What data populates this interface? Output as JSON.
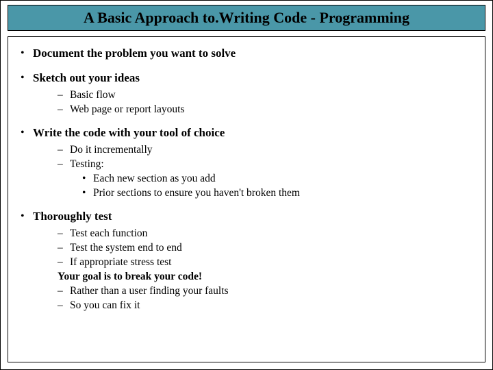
{
  "title": "A Basic Approach to.Writing Code - Programming",
  "b1": "Document the problem you want to solve",
  "b2": "Sketch out your ideas",
  "b2s1": "Basic flow",
  "b2s2": "Web page or report layouts",
  "b3": "Write the code with your tool of choice",
  "b3s1": "Do it incrementally",
  "b3s2": "Testing:",
  "b3t1": "Each new section as you add",
  "b3t2": "Prior sections to ensure you haven't broken them",
  "b4": "Thoroughly test",
  "b4s1": "Test each function",
  "b4s2": "Test the system end to end",
  "b4s3": "If appropriate stress test",
  "b4bold": "Your goal is to break your code!",
  "b4s4": "Rather than a user finding your faults",
  "b4s5": "So you can fix it"
}
